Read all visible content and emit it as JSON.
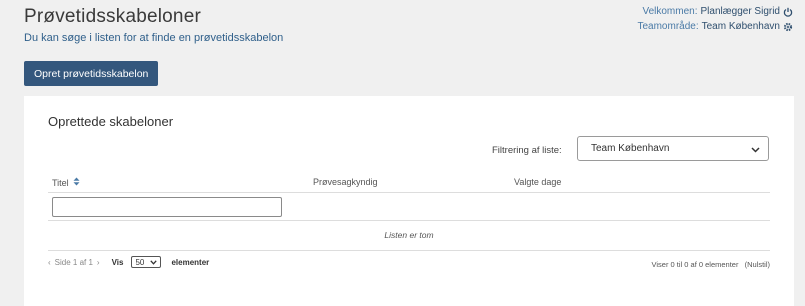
{
  "header": {
    "title": "Prøvetidsskabeloner",
    "subtitle": "Du kan søge i listen for at finde en prøvetidsskabelon",
    "welcome_label": "Velkommen:",
    "welcome_user": "Planlægger Sigrid",
    "team_label": "Teamområde:",
    "team_value": "Team København",
    "icons": [
      "power-icon",
      "gear-icon"
    ]
  },
  "toolbar": {
    "create_label": "Opret prøvetidsskabelon"
  },
  "list": {
    "title": "Oprettede skabeloner",
    "filter_label": "Filtrering af liste:",
    "filter_value": "Team København",
    "columns": [
      "Titel",
      "Prøvesagkyndig",
      "Valgte dage"
    ],
    "empty_text": "Listen er tom"
  },
  "pagination": {
    "prev": "‹",
    "page_text": "Side 1 af 1",
    "next": "›",
    "show_label": "Vis",
    "page_size": "50",
    "unit_label": "elementer",
    "summary": "Viser 0 til 0 af 0 elementer",
    "reset_label": "(Nulstil)"
  },
  "colors": {
    "accent": "#34577d",
    "link": "#2f5f8a",
    "background": "#f0f0f0"
  }
}
